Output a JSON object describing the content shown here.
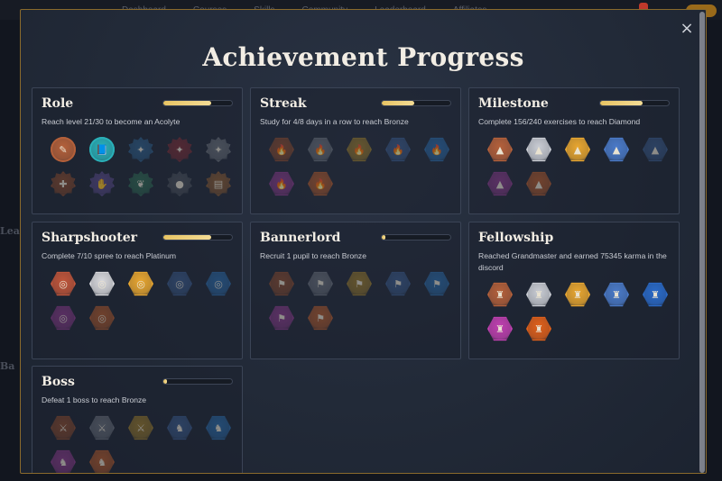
{
  "background": {
    "nav": [
      "Dashboard",
      "Courses",
      "Skills",
      "Community",
      "Leaderboard",
      "Affiliates"
    ],
    "left_heading_1": "Lea",
    "left_heading_2": "Ba"
  },
  "modal": {
    "title": "Achievement Progress",
    "close_icon": "×"
  },
  "colors": {
    "accent": "#e8c463",
    "border": "#8a6a2c"
  },
  "cards": [
    {
      "name": "Role",
      "desc": "Reach level 21/30 to become an Acolyte",
      "progress": 0.7,
      "badges": [
        {
          "icon": "scroll-icon",
          "glyph": "✎",
          "shape": "circle",
          "color": "#b4603a",
          "active": true
        },
        {
          "icon": "book-icon",
          "glyph": "📘",
          "shape": "circle",
          "color": "#2ab0b8",
          "active": true
        },
        {
          "icon": "wand-icon",
          "glyph": "✦",
          "shape": "star",
          "color": "#2e5f8a",
          "active": false
        },
        {
          "icon": "dagger-icon",
          "glyph": "✦",
          "shape": "star",
          "color": "#7a2c34",
          "active": false
        },
        {
          "icon": "quill-icon",
          "glyph": "✦",
          "shape": "star",
          "color": "#6a7078",
          "active": false
        },
        {
          "icon": "cross-icon",
          "glyph": "✚",
          "shape": "star",
          "color": "#8a4a2c",
          "active": false
        },
        {
          "icon": "hand-icon",
          "glyph": "✋",
          "shape": "star",
          "color": "#5a4a8a",
          "active": false
        },
        {
          "icon": "leaf-icon",
          "glyph": "❦",
          "shape": "star",
          "color": "#2f6a52",
          "active": false
        },
        {
          "icon": "orb-icon",
          "glyph": "●",
          "shape": "star",
          "color": "#4a505a",
          "active": false
        },
        {
          "icon": "tome-icon",
          "glyph": "▤",
          "shape": "star",
          "color": "#8a5a30",
          "active": false
        }
      ]
    },
    {
      "name": "Streak",
      "desc": "Study for 4/8 days in a row to reach Bronze",
      "progress": 0.48,
      "badges": [
        {
          "icon": "flame-icon",
          "glyph": "🔥",
          "shape": "hex",
          "color": "#8a4a2c",
          "active": false
        },
        {
          "icon": "flame-icon",
          "glyph": "🔥",
          "shape": "hex",
          "color": "#6a707a",
          "active": false
        },
        {
          "icon": "flame-icon",
          "glyph": "🔥",
          "shape": "hex",
          "color": "#9a7a2a",
          "active": false
        },
        {
          "icon": "flame-icon",
          "glyph": "🔥",
          "shape": "hex",
          "color": "#3a5a8a",
          "active": false
        },
        {
          "icon": "flame-icon",
          "glyph": "🔥",
          "shape": "hex",
          "color": "#2a6aa8",
          "active": false
        },
        {
          "icon": "flame-icon",
          "glyph": "🔥",
          "shape": "hex",
          "color": "#8a3a8a",
          "active": false
        },
        {
          "icon": "flame-icon",
          "glyph": "🔥",
          "shape": "hex",
          "color": "#b45a2a",
          "active": false
        }
      ]
    },
    {
      "name": "Milestone",
      "desc": "Complete 156/240 exercises to reach Diamond",
      "progress": 0.62,
      "badges": [
        {
          "icon": "mountain-icon",
          "glyph": "▲",
          "shape": "hex",
          "color": "#b4603a",
          "active": true
        },
        {
          "icon": "mountain-icon",
          "glyph": "▲",
          "shape": "hex",
          "color": "#c9ccd3",
          "active": true
        },
        {
          "icon": "mountain-icon",
          "glyph": "▲",
          "shape": "hex",
          "color": "#e8a630",
          "active": true
        },
        {
          "icon": "mountain-icon",
          "glyph": "▲",
          "shape": "hex",
          "color": "#4a7ac8",
          "active": true
        },
        {
          "icon": "mountain-icon",
          "glyph": "▲",
          "shape": "hex",
          "color": "#3a5a8a",
          "active": false
        },
        {
          "icon": "mountain-icon",
          "glyph": "▲",
          "shape": "hex",
          "color": "#8a3a8a",
          "active": false
        },
        {
          "icon": "mountain-icon",
          "glyph": "▲",
          "shape": "hex",
          "color": "#b45a2a",
          "active": false
        }
      ]
    },
    {
      "name": "Sharpshooter",
      "desc": "Complete 7/10 spree to reach Platinum",
      "progress": 0.7,
      "badges": [
        {
          "icon": "target-icon",
          "glyph": "◎",
          "shape": "hex",
          "color": "#c0553a",
          "active": true
        },
        {
          "icon": "target-icon",
          "glyph": "◎",
          "shape": "hex",
          "color": "#d8d8dc",
          "active": true
        },
        {
          "icon": "target-icon",
          "glyph": "◎",
          "shape": "hex",
          "color": "#e8a630",
          "active": true
        },
        {
          "icon": "target-icon",
          "glyph": "◎",
          "shape": "hex",
          "color": "#3a5a8a",
          "active": false
        },
        {
          "icon": "target-icon",
          "glyph": "◎",
          "shape": "hex",
          "color": "#2a6aa8",
          "active": false
        },
        {
          "icon": "target-icon",
          "glyph": "◎",
          "shape": "hex",
          "color": "#8a3a8a",
          "active": false
        },
        {
          "icon": "target-icon",
          "glyph": "◎",
          "shape": "hex",
          "color": "#b45a2a",
          "active": false
        }
      ]
    },
    {
      "name": "Bannerlord",
      "desc": "Recruit 1 pupil to reach Bronze",
      "progress": 0.05,
      "badges": [
        {
          "icon": "banner-icon",
          "glyph": "⚑",
          "shape": "hex",
          "color": "#8a4a2c",
          "active": false
        },
        {
          "icon": "banner-icon",
          "glyph": "⚑",
          "shape": "hex",
          "color": "#6a707a",
          "active": false
        },
        {
          "icon": "banner-icon",
          "glyph": "⚑",
          "shape": "hex",
          "color": "#9a7a2a",
          "active": false
        },
        {
          "icon": "banner-icon",
          "glyph": "⚑",
          "shape": "hex",
          "color": "#3a5a8a",
          "active": false
        },
        {
          "icon": "banner-icon",
          "glyph": "⚑",
          "shape": "hex",
          "color": "#2a6aa8",
          "active": false
        },
        {
          "icon": "banner-icon",
          "glyph": "⚑",
          "shape": "hex",
          "color": "#8a3a8a",
          "active": false
        },
        {
          "icon": "banner-icon",
          "glyph": "⚑",
          "shape": "hex",
          "color": "#b45a2a",
          "active": false
        }
      ]
    },
    {
      "name": "Fellowship",
      "desc": "Reached Grandmaster and earned 75345 karma in the discord",
      "progress": null,
      "badges": [
        {
          "icon": "castle-icon",
          "glyph": "♜",
          "shape": "hex",
          "color": "#b4603a",
          "active": true
        },
        {
          "icon": "castle-icon",
          "glyph": "♜",
          "shape": "hex",
          "color": "#c9ccd3",
          "active": true
        },
        {
          "icon": "castle-icon",
          "glyph": "♜",
          "shape": "hex",
          "color": "#e8a630",
          "active": true
        },
        {
          "icon": "castle-icon",
          "glyph": "♜",
          "shape": "hex",
          "color": "#4a7ac8",
          "active": true
        },
        {
          "icon": "castle-icon",
          "glyph": "♜",
          "shape": "hex",
          "color": "#2a6ac8",
          "active": true
        },
        {
          "icon": "castle-icon",
          "glyph": "♜",
          "shape": "hex",
          "color": "#c040b0",
          "active": true
        },
        {
          "icon": "castle-icon",
          "glyph": "♜",
          "shape": "hex",
          "color": "#e0601a",
          "active": true
        }
      ]
    },
    {
      "name": "Boss",
      "desc": "Defeat 1 boss to reach Bronze",
      "progress": 0.05,
      "badges": [
        {
          "icon": "sword-icon",
          "glyph": "⚔",
          "shape": "hex",
          "color": "#8a4a2c",
          "active": false
        },
        {
          "icon": "sword-icon",
          "glyph": "⚔",
          "shape": "hex",
          "color": "#6a707a",
          "active": false
        },
        {
          "icon": "sword-icon",
          "glyph": "⚔",
          "shape": "hex",
          "color": "#9a7a2a",
          "active": false
        },
        {
          "icon": "demon-icon",
          "glyph": "♞",
          "shape": "hex",
          "color": "#3a5a8a",
          "active": false
        },
        {
          "icon": "demon-icon",
          "glyph": "♞",
          "shape": "hex",
          "color": "#2a6aa8",
          "active": false
        },
        {
          "icon": "demon-icon",
          "glyph": "♞",
          "shape": "hex",
          "color": "#8a3a8a",
          "active": false
        },
        {
          "icon": "demon-icon",
          "glyph": "♞",
          "shape": "hex",
          "color": "#b45a2a",
          "active": false
        }
      ]
    }
  ]
}
